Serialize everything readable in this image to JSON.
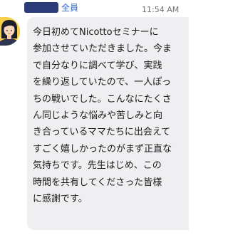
{
  "header": {
    "recipient": "全員",
    "timestamp": "11:54 AM"
  },
  "message": {
    "text": "今日初めてNicottoセミナーに\n参加させていただきました。今ま\nで自分なりに調べて学び、実践\nを繰り返していたので、一人ぽっ\nちの戦いでした。こんなにたくさ\nん同じような悩みや苦しみと向\nき合っているママたちに出会えて\nすごく嬉しかったのがまず正直な\n気持ちです。先生はじめ、この\n時間を共有してくださった皆様\nに感謝です。"
  },
  "colors": {
    "name_bar": "#2b3a78",
    "recipient": "#2f63c8",
    "bubble": "#efeff2",
    "avatar_bg": "#f6d04a"
  },
  "icons": {
    "avatar": "woman-avatar-icon"
  }
}
